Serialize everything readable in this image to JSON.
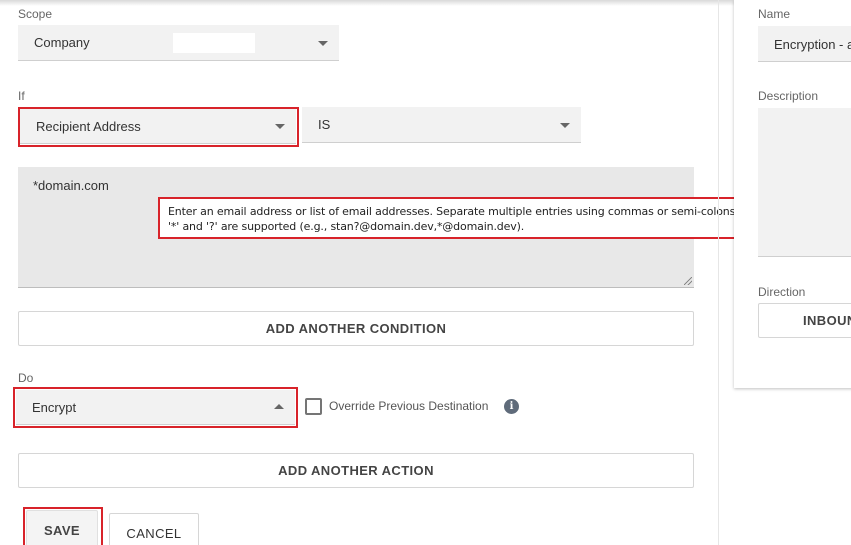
{
  "scope": {
    "label": "Scope",
    "value": "Company"
  },
  "condition": {
    "label": "If",
    "field_value": "Recipient Address",
    "operator_value": "IS",
    "textarea_value": "*domain.com",
    "tooltip": "Enter an email address or list of email addresses. Separate multiple entries using commas or semi-colons. Wildcard symbols '*' and '?' are supported (e.g., stan?@domain.dev,*@domain.dev).",
    "add_condition_label": "ADD ANOTHER CONDITION"
  },
  "action": {
    "label": "Do",
    "value": "Encrypt",
    "override_label": "Override Previous Destination",
    "info_icon": "i",
    "add_action_label": "ADD ANOTHER ACTION"
  },
  "footer": {
    "save_label": "SAVE",
    "cancel_label": "CANCEL"
  },
  "right_panel": {
    "name_label": "Name",
    "name_value": "Encryption - a",
    "description_label": "Description",
    "direction_label": "Direction",
    "direction_value": "INBOUN"
  },
  "colors": {
    "highlight": "#d8232a",
    "field_bg": "#f2f2f2",
    "textarea_bg": "#e8e8e8"
  }
}
